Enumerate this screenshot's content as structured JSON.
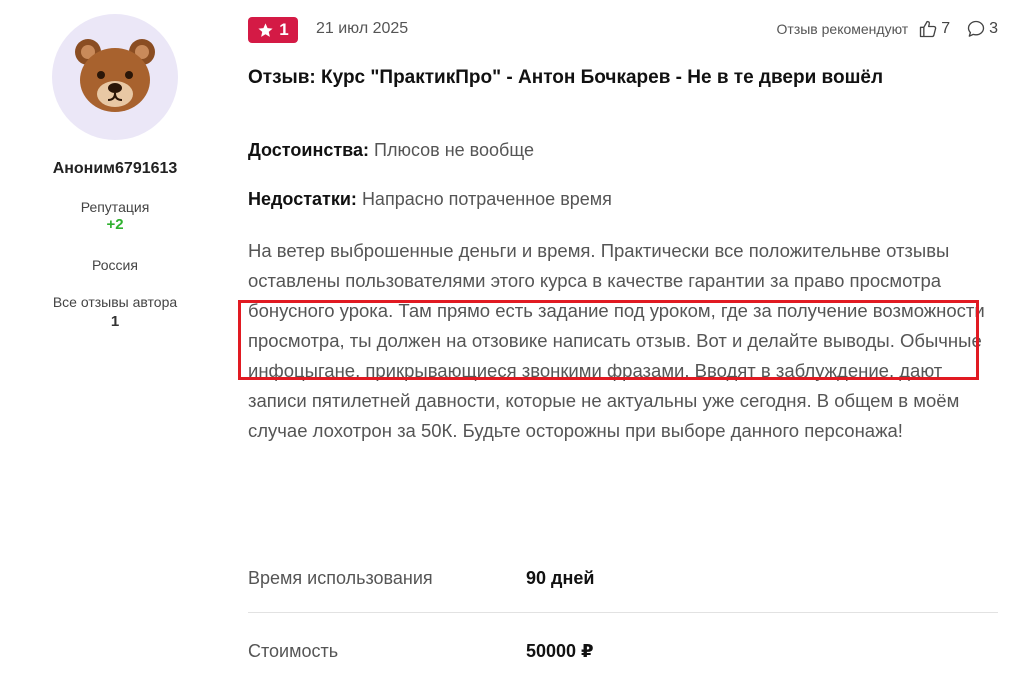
{
  "author": {
    "name": "Аноним6791613",
    "reputation_label": "Репутация",
    "reputation_value": "+2",
    "country": "Россия",
    "all_reviews_label": "Все отзывы автора",
    "all_reviews_count": "1",
    "avatar_icon": "bear-avatar-icon"
  },
  "review": {
    "rating": "1",
    "date": "21 июл 2025",
    "recommend_label": "Отзыв рекомендуют",
    "likes": "7",
    "comments": "3",
    "title": "Отзыв: Курс \"ПрактикПро\" - Антон Бочкарев - Не в те двери вошёл",
    "pros_label": "Достоинства:",
    "pros_text": "Плюсов не вообще",
    "cons_label": "Недостатки:",
    "cons_text": "Напрасно потраченное время",
    "body": "На ветер выброшенные деньги и время. Практически все положительнве отзывы оставлены пользователями этого курса в качестве гарантии за право просмотра бонусного урока. Там прямо есть задание под уроком, где за получение возможности просмотра, ты должен на отзовике написать отзыв. Вот и делайте выводы. Обычные инфоцыгане, прикрывающиеся звонкими фразами. Вводят в заблуждение, дают записи пятилетней давности, которые не актуальны уже сегодня. В общем в моём случае лохотрон за 50К. Будьте осторожны при выборе данного персонажа!"
  },
  "details": {
    "usage_label": "Время использования",
    "usage_value": "90 дней",
    "cost_label": "Стоимость",
    "cost_value": "50000 ₽"
  },
  "colors": {
    "rating_badge": "#d41a45",
    "reputation_positive": "#2fb12f",
    "highlight_border": "#e11a22"
  }
}
